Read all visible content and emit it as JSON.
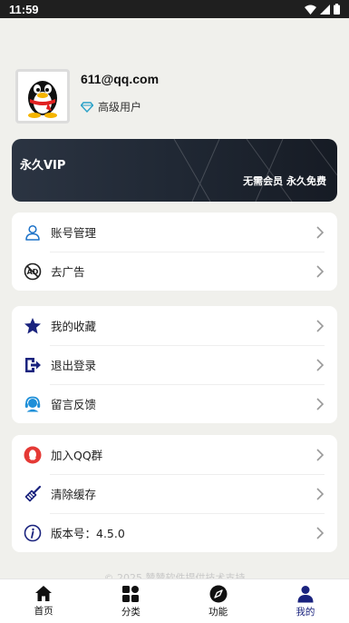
{
  "status_bar": {
    "time": "11:59"
  },
  "profile": {
    "email": "611@qq.com",
    "level": "高级用户"
  },
  "vip_banner": {
    "title": "永久VIP",
    "subtitle": "无需会员 永久免费"
  },
  "menu_group_1": [
    {
      "label": "账号管理",
      "icon": "user-icon"
    },
    {
      "label": "去广告",
      "icon": "no-ads-icon"
    }
  ],
  "menu_group_2": [
    {
      "label": "我的收藏",
      "icon": "star-icon"
    },
    {
      "label": "退出登录",
      "icon": "logout-icon"
    },
    {
      "label": "留言反馈",
      "icon": "headset-icon"
    }
  ],
  "menu_group_3": [
    {
      "label": "加入QQ群",
      "icon": "qq-icon"
    },
    {
      "label": "清除缓存",
      "icon": "broom-icon"
    },
    {
      "label": "版本号：4.5.0",
      "icon": "info-icon"
    }
  ],
  "footer": {
    "copyright": "© 2025 赞赞软件提供技术支持"
  },
  "tab_bar": {
    "tabs": [
      {
        "label": "首页",
        "icon": "home-icon"
      },
      {
        "label": "分类",
        "icon": "grid-icon"
      },
      {
        "label": "功能",
        "icon": "compass-icon"
      },
      {
        "label": "我的",
        "icon": "person-icon"
      }
    ],
    "active": "我的"
  },
  "colors": {
    "accent": "#1a237e",
    "qq_red": "#e53935",
    "background": "#f0f0ec"
  }
}
